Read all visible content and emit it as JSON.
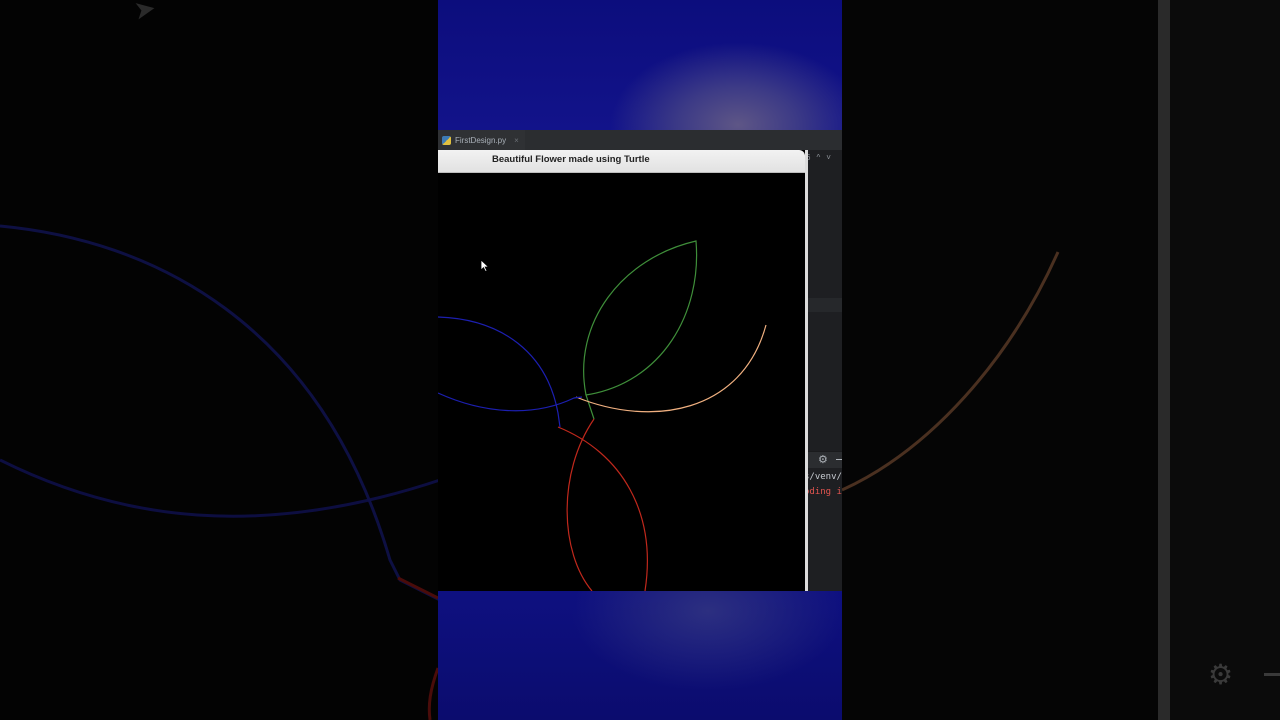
{
  "ide": {
    "tab_label": "FirstDesign.py",
    "tab_close": "×",
    "nav_counter": "6",
    "nav_up": "^",
    "nav_down": "˅",
    "console_line_1": "s/venv/",
    "console_line_2": "oding i"
  },
  "turtle_window": {
    "title": "Beautiful Flower made using Turtle"
  },
  "colors": {
    "petal_green": "#3f8f3a",
    "petal_peach": "#f0b080",
    "petal_red": "#c0281c",
    "petal_blue": "#1c1fb0",
    "desktop_blue": "#10128a"
  }
}
